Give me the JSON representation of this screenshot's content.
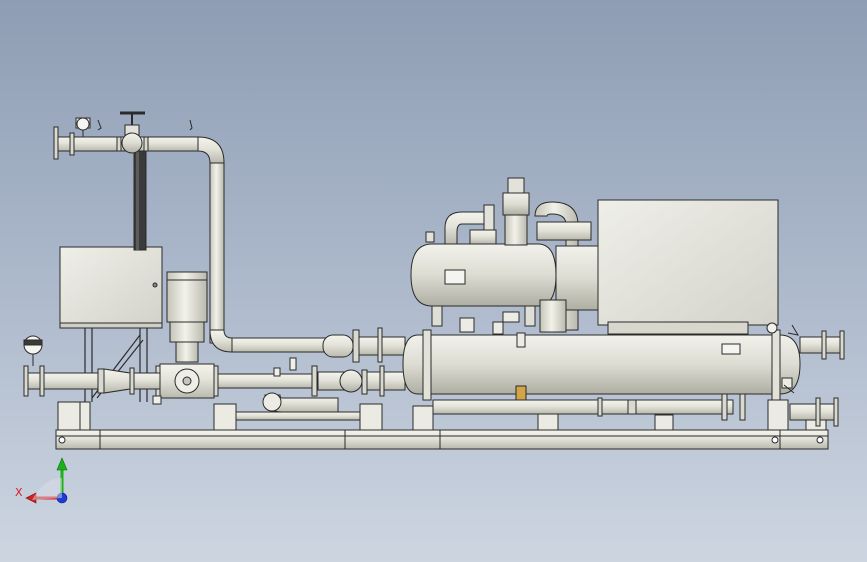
{
  "viewport": {
    "background_top": "#8f9db4",
    "background_bottom": "#cdd5e1",
    "metal_color": "#e6e6de",
    "outline_color": "#2b2b2b"
  },
  "axis_triad": {
    "x_label": "X",
    "x_color": "#d42020",
    "y_color": "#19b319",
    "z_color": "#1f3bd6"
  }
}
